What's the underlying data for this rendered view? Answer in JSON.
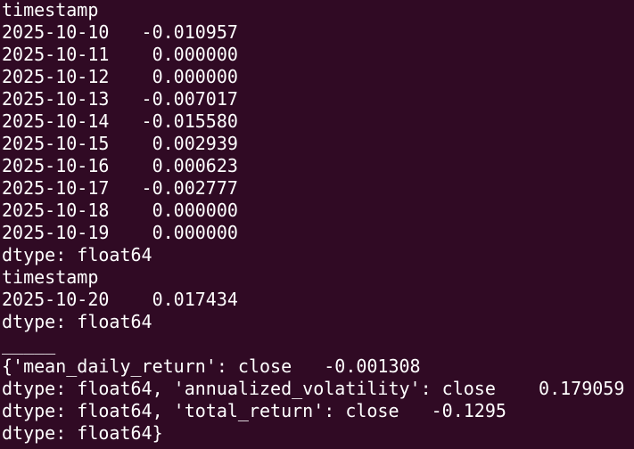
{
  "terminal": {
    "lines": [
      "timestamp",
      "2025-10-10   -0.010957",
      "2025-10-11    0.000000",
      "2025-10-12    0.000000",
      "2025-10-13   -0.007017",
      "2025-10-14   -0.015580",
      "2025-10-15    0.002939",
      "2025-10-16    0.000623",
      "2025-10-17   -0.002777",
      "2025-10-18    0.000000",
      "2025-10-19    0.000000",
      "dtype: float64",
      "timestamp",
      "2025-10-20    0.017434",
      "dtype: float64",
      "_____",
      "{'mean_daily_return': close   -0.001308",
      "dtype: float64, 'annualized_volatility': close    0.179059",
      "dtype: float64, 'total_return': close   -0.1295",
      "dtype: float64}"
    ]
  },
  "colors": {
    "background": "#300a24",
    "foreground": "#ffffff"
  }
}
